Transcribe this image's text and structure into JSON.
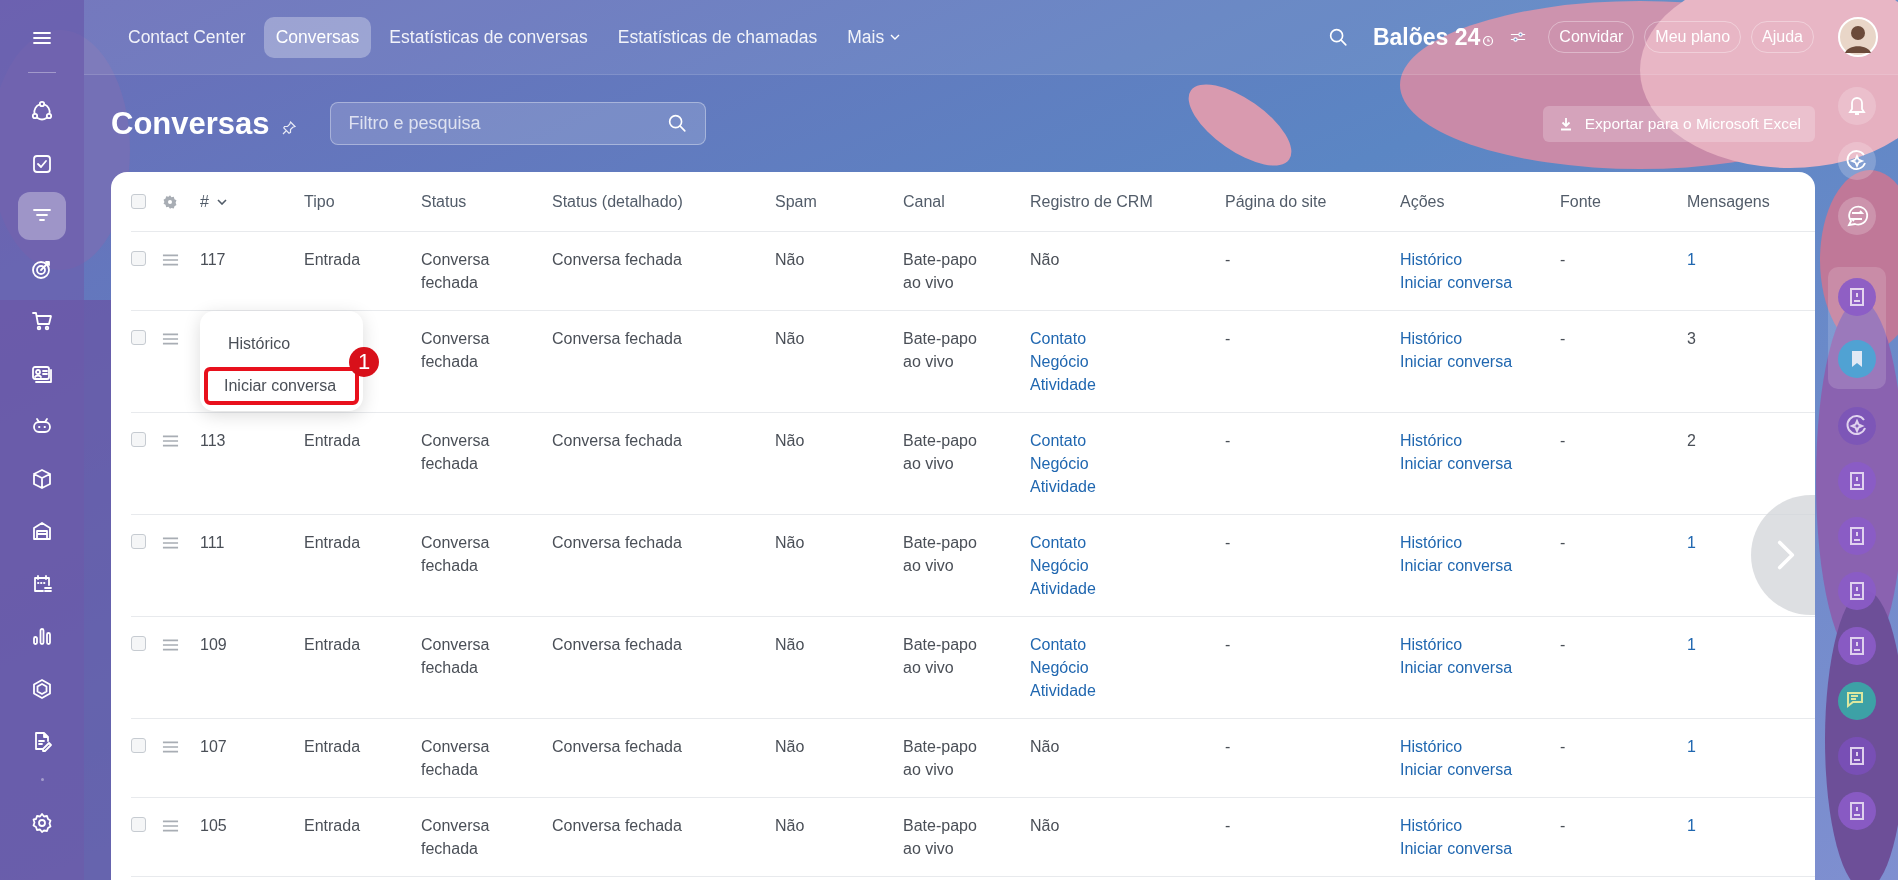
{
  "top_nav": {
    "tabs": [
      {
        "label": "Contact Center",
        "selected": false
      },
      {
        "label": "Conversas",
        "selected": true
      },
      {
        "label": "Estatísticas de conversas",
        "selected": false
      },
      {
        "label": "Estatísticas de chamadas",
        "selected": false
      }
    ],
    "more": "Mais"
  },
  "brand": {
    "name": "Balões 24"
  },
  "header_buttons": [
    "Convidar",
    "Meu plano",
    "Ajuda"
  ],
  "sidebar": {
    "items": [
      {
        "selected": false
      },
      {
        "selected": false
      },
      {
        "selected": true
      },
      {
        "selected": false
      },
      {
        "selected": false
      },
      {
        "selected": false
      },
      {
        "selected": false
      },
      {
        "selected": false
      },
      {
        "selected": false
      },
      {
        "selected": false
      },
      {
        "selected": false
      },
      {
        "selected": false
      },
      {
        "selected": false
      }
    ]
  },
  "page": {
    "title": "Conversas",
    "search": {
      "placeholder": "Filtro e pesquisa"
    },
    "export_button": "Exportar para o Microsoft Excel"
  },
  "table": {
    "select_all": false,
    "columns": [
      "#",
      "Tipo",
      "Status",
      "Status (detalhado)",
      "Spam",
      "Canal",
      "Registro de CRM",
      "Página do site",
      "Ações",
      "Fonte",
      "Mensagens"
    ],
    "rows": [
      {
        "checked": false,
        "id": "117",
        "type": "Entrada",
        "status": "Conversa fechada",
        "status_detail": "Conversa fechada",
        "spam": "Não",
        "channel": "Bate-papo ao vivo",
        "crm": {
          "kind": "text",
          "items": [
            "Não"
          ]
        },
        "page": "-",
        "actions": [
          "Histórico",
          "Iniciar conversa"
        ],
        "source": "-",
        "messages": {
          "text": "1",
          "link": true
        }
      },
      {
        "checked": false,
        "menu_open": true,
        "status": "Conversa fechada",
        "status_detail": "Conversa fechada",
        "spam": "Não",
        "channel": "Bate-papo ao vivo",
        "crm": {
          "kind": "links",
          "items": [
            "Contato",
            "Negócio",
            "Atividade"
          ]
        },
        "page": "-",
        "actions": [
          "Histórico",
          "Iniciar conversa"
        ],
        "source": "-",
        "messages": {
          "text": "3",
          "link": false
        }
      },
      {
        "checked": false,
        "id": "113",
        "type": "Entrada",
        "status": "Conversa fechada",
        "status_detail": "Conversa fechada",
        "spam": "Não",
        "channel": "Bate-papo ao vivo",
        "crm": {
          "kind": "links",
          "items": [
            "Contato",
            "Negócio",
            "Atividade"
          ]
        },
        "page": "-",
        "actions": [
          "Histórico",
          "Iniciar conversa"
        ],
        "source": "-",
        "messages": {
          "text": "2",
          "link": false
        }
      },
      {
        "checked": false,
        "id": "111",
        "type": "Entrada",
        "status": "Conversa fechada",
        "status_detail": "Conversa fechada",
        "spam": "Não",
        "channel": "Bate-papo ao vivo",
        "crm": {
          "kind": "links",
          "items": [
            "Contato",
            "Negócio",
            "Atividade"
          ]
        },
        "page": "-",
        "actions": [
          "Histórico",
          "Iniciar conversa"
        ],
        "source": "-",
        "messages": {
          "text": "1",
          "link": true
        }
      },
      {
        "checked": false,
        "id": "109",
        "type": "Entrada",
        "status": "Conversa fechada",
        "status_detail": "Conversa fechada",
        "spam": "Não",
        "channel": "Bate-papo ao vivo",
        "crm": {
          "kind": "links",
          "items": [
            "Contato",
            "Negócio",
            "Atividade"
          ]
        },
        "page": "-",
        "actions": [
          "Histórico",
          "Iniciar conversa"
        ],
        "source": "-",
        "messages": {
          "text": "1",
          "link": true
        }
      },
      {
        "checked": false,
        "id": "107",
        "type": "Entrada",
        "status": "Conversa fechada",
        "status_detail": "Conversa fechada",
        "spam": "Não",
        "channel": "Bate-papo ao vivo",
        "crm": {
          "kind": "text",
          "items": [
            "Não"
          ]
        },
        "page": "-",
        "actions": [
          "Histórico",
          "Iniciar conversa"
        ],
        "source": "-",
        "messages": {
          "text": "1",
          "link": true
        }
      },
      {
        "checked": false,
        "id": "105",
        "type": "Entrada",
        "status": "Conversa fechada",
        "status_detail": "Conversa fechada",
        "spam": "Não",
        "channel": "Bate-papo ao vivo",
        "crm": {
          "kind": "text",
          "items": [
            "Não"
          ]
        },
        "page": "-",
        "actions": [
          "Histórico",
          "Iniciar conversa"
        ],
        "source": "-",
        "messages": {
          "text": "1",
          "link": true
        }
      }
    ]
  },
  "context_menu": {
    "items": [
      {
        "label": "Histórico",
        "highlighted": false
      },
      {
        "label": "Iniciar conversa",
        "highlighted": true
      }
    ],
    "step_badge": "1"
  }
}
